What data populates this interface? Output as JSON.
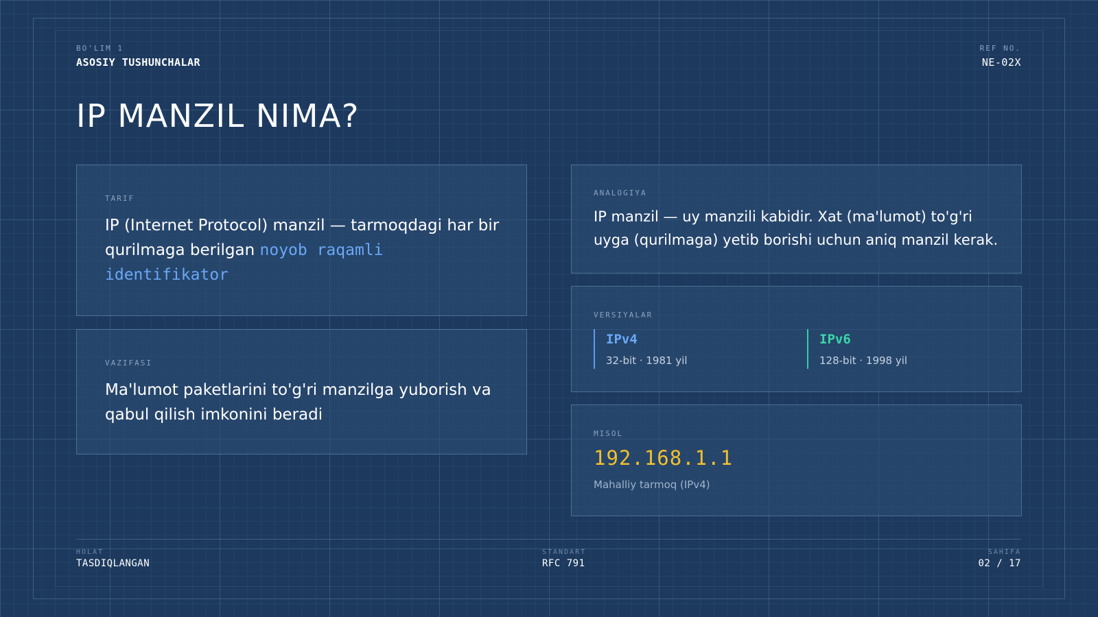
{
  "header": {
    "section_label": "BO'LIM 1",
    "section_title": "ASOSIY TUSHUNCHALAR",
    "ref_label": "REF NO.",
    "ref_value": "NE-02X"
  },
  "title": "IP MANZIL NIMA?",
  "definition": {
    "label": "TARIF",
    "text": "IP (Internet Protocol) manzil — tarmoqdagi har bir qurilmaga berilgan ",
    "highlight": "noyob raqamli identifikator"
  },
  "function": {
    "label": "VAZIFASI",
    "text": "Ma'lumot paketlarini to'g'ri manzilga yuborish va qabul qilish imkonini beradi"
  },
  "analogy": {
    "label": "ANALOGIYA",
    "text": "IP manzil — uy manzili kabidir. Xat (ma'lumot) to'g'ri uyga (qurilmaga) yetib borishi uchun aniq manzil kerak."
  },
  "versions": {
    "label": "VERSIYALAR",
    "items": [
      {
        "name": "IPv4",
        "desc": "32-bit · 1981 yil",
        "color": "#6aaaf7"
      },
      {
        "name": "IPv6",
        "desc": "128-bit · 1998 yil",
        "color": "#3ad6a8"
      }
    ]
  },
  "example": {
    "label": "MISOL",
    "ip": "192.168.1.1",
    "desc": "Mahalliy tarmoq (IPv4)"
  },
  "footer": {
    "status_label": "HOLAT",
    "status_value": "TASDIQLANGAN",
    "standard_label": "STANDART",
    "standard_value": "RFC 791",
    "page_label": "SAHIFA",
    "page_value": "02 / 17"
  },
  "colors": {
    "background": "#1d3a5e",
    "accent_blue": "#6aa8f5",
    "accent_green": "#3ad6a8",
    "accent_yellow": "#f2c02e"
  }
}
